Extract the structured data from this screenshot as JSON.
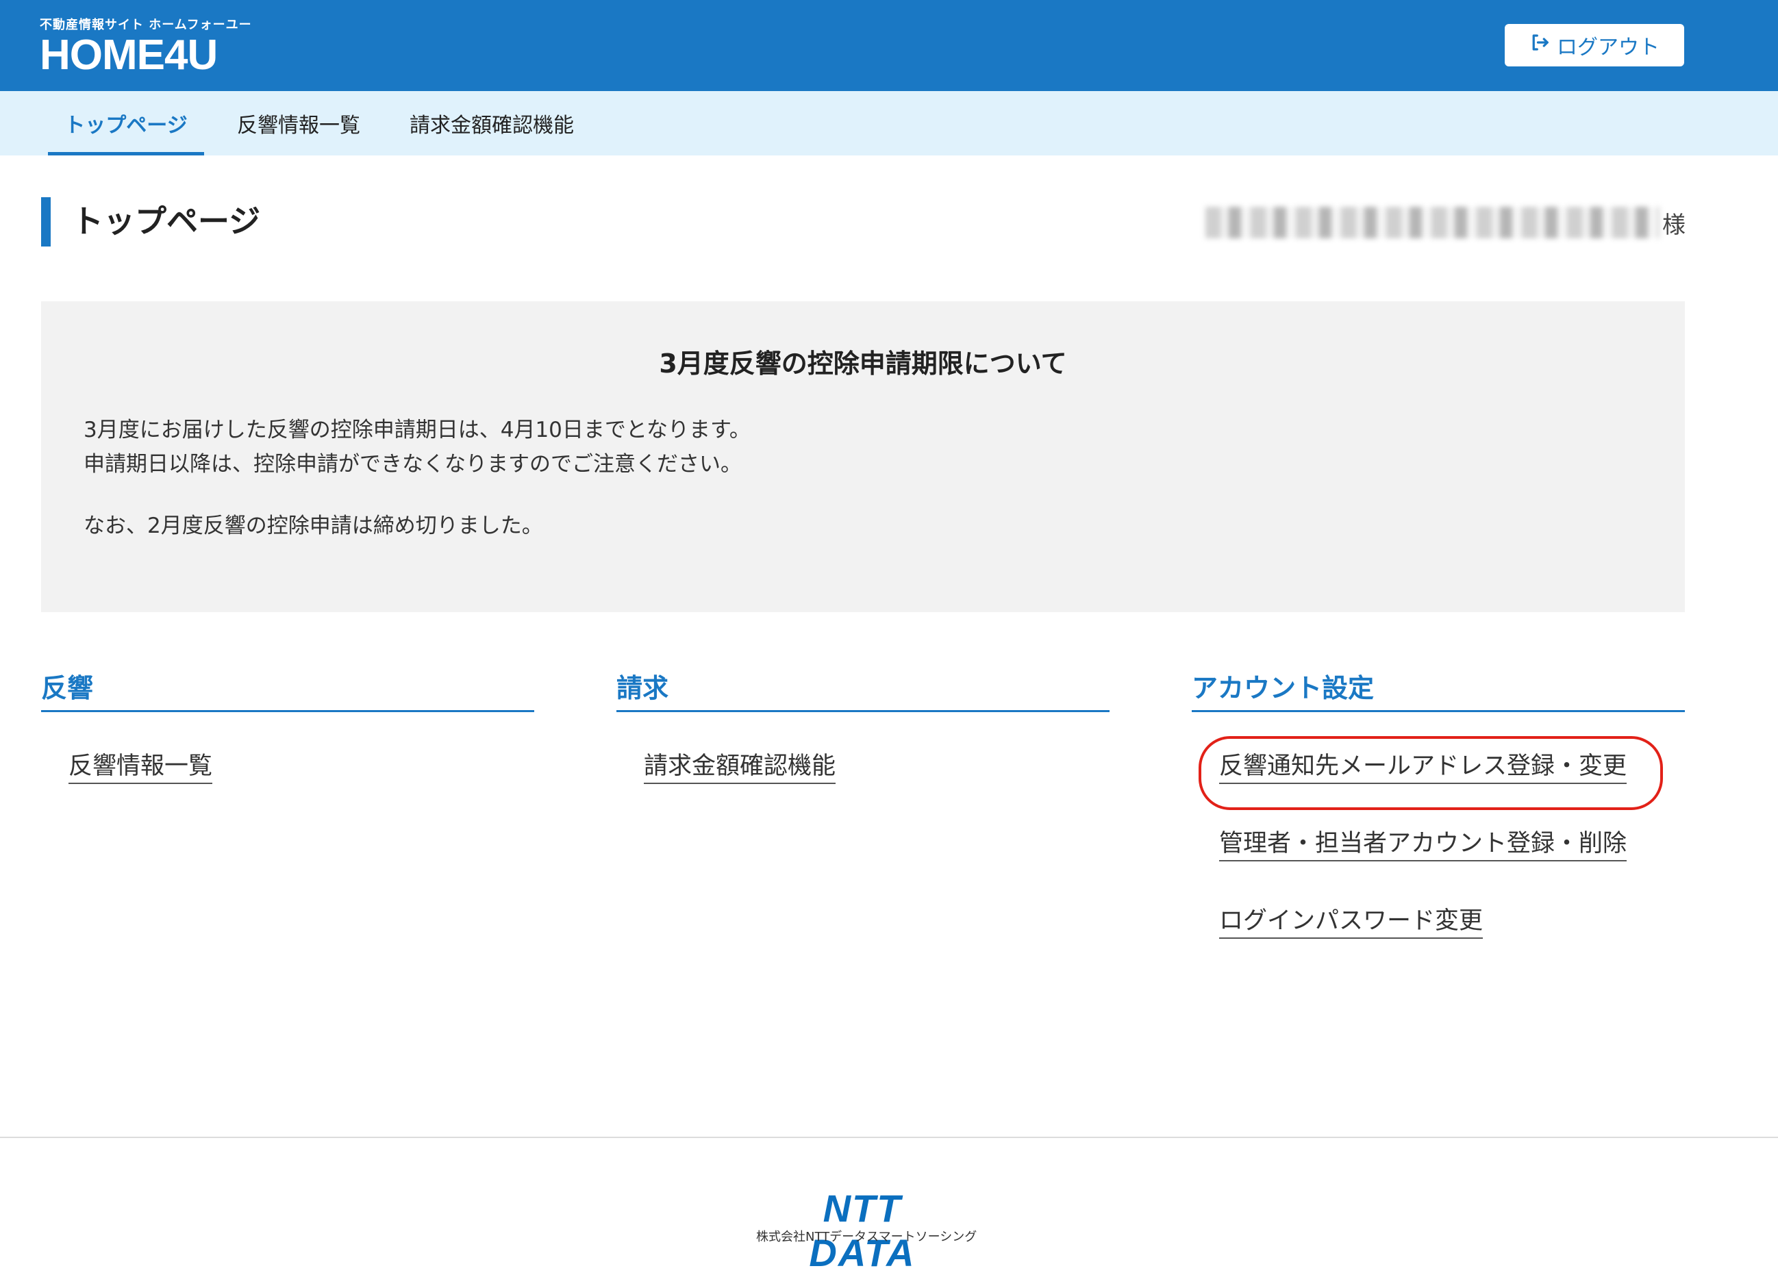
{
  "header": {
    "logo_tagline": "不動産情報サイト ホームフォーユー",
    "logo_text": "HOME4U",
    "logout_label": "ログアウト"
  },
  "nav": {
    "tabs": [
      {
        "label": "トップページ",
        "active": true
      },
      {
        "label": "反響情報一覧",
        "active": false
      },
      {
        "label": "請求金額確認機能",
        "active": false
      }
    ]
  },
  "page": {
    "title": "トップページ",
    "user_suffix": "様"
  },
  "notice": {
    "title": "3月度反響の控除申請期限について",
    "lines": [
      "3月度にお届けした反響の控除申請期日は、4月10日までとなります。",
      "申請期日以降は、控除申請ができなくなりますのでご注意ください。",
      "なお、2月度反響の控除申請は締め切りました。"
    ]
  },
  "sections": [
    {
      "heading": "反響",
      "links": [
        "反響情報一覧"
      ]
    },
    {
      "heading": "請求",
      "links": [
        "請求金額確認機能"
      ]
    },
    {
      "heading": "アカウント設定",
      "links": [
        "反響通知先メールアドレス登録・変更",
        "管理者・担当者アカウント登録・削除",
        "ログインパスワード変更"
      ]
    }
  ],
  "footer": {
    "logo_text": "NTT DATA",
    "company": "株式会社NTTデータスマートソーシング"
  },
  "colors": {
    "brand_blue": "#1a78c4",
    "nav_bg": "#e0f2fc",
    "notice_bg": "#f2f2f2",
    "highlight": "#e22118"
  }
}
